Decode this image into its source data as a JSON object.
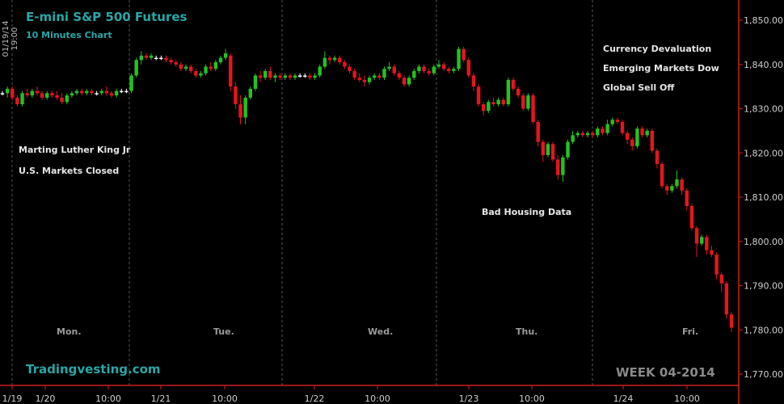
{
  "header": {
    "title": "E-mini S&P 500 Futures",
    "subtitle": "10 Minutes Chart",
    "timestamp": "01/19/14 19:00"
  },
  "footer": {
    "brand": "Tradingvesting.com",
    "week": "WEEK 04-2014"
  },
  "annotations": {
    "mlk_line1": "Marting Luther King Jr",
    "mlk_line2": "U.S. Markets Closed",
    "housing": "Bad Housing Data",
    "currency": "Currency Devaluation",
    "emerging": "Emerging Markets Dow",
    "selloff": "Global Sell Off"
  },
  "days": {
    "mon": "Mon.",
    "tue": "Tue.",
    "wed": "Wed.",
    "thu": "Thu.",
    "fri": "Fri."
  },
  "colors": {
    "background": "#000000",
    "up_candle": "#22c322",
    "down_candle": "#e8141e",
    "axis_line": "#cc1f1f",
    "title": "#2aa6a6"
  },
  "chart_data": {
    "type": "candlestick",
    "title": "E-mini S&P 500 Futures",
    "subtitle": "10 Minutes Chart",
    "ylim": [
      1770,
      1855
    ],
    "y_ticks": [
      "1,770.00",
      "1,780.00",
      "1,790.00",
      "1,800.00",
      "1,810.00",
      "1,820.00",
      "1,830.00",
      "1,840.00",
      "1,850.00"
    ],
    "x_ticks": [
      "1/19",
      "1/20",
      "10:00",
      "1/21",
      "10:00",
      "1/22",
      "10:00",
      "1/23",
      "10:00",
      "1/24",
      "10:00"
    ],
    "candles": [
      [
        1833.5,
        1834.0,
        1833.0,
        1833.5
      ],
      [
        1833.5,
        1835.0,
        1832.5,
        1834.5
      ],
      [
        1834.5,
        1835.0,
        1832.0,
        1832.5
      ],
      [
        1832.5,
        1833.0,
        1830.5,
        1831.0
      ],
      [
        1831.0,
        1834.0,
        1830.5,
        1833.5
      ],
      [
        1833.5,
        1834.5,
        1832.5,
        1833.0
      ],
      [
        1833.0,
        1834.5,
        1832.5,
        1834.0
      ],
      [
        1834.0,
        1835.0,
        1833.0,
        1833.5
      ],
      [
        1833.5,
        1834.0,
        1832.0,
        1832.5
      ],
      [
        1832.5,
        1834.0,
        1832.0,
        1833.5
      ],
      [
        1833.5,
        1834.0,
        1832.5,
        1833.0
      ],
      [
        1833.0,
        1834.0,
        1832.0,
        1832.5
      ],
      [
        1832.5,
        1833.5,
        1831.0,
        1831.5
      ],
      [
        1831.5,
        1833.5,
        1831.0,
        1833.0
      ],
      [
        1833.0,
        1834.0,
        1832.5,
        1833.5
      ],
      [
        1833.5,
        1834.5,
        1833.0,
        1834.0
      ],
      [
        1834.0,
        1834.5,
        1833.0,
        1833.5
      ],
      [
        1833.5,
        1834.5,
        1833.0,
        1834.0
      ],
      [
        1834.0,
        1834.5,
        1833.0,
        1833.5
      ],
      [
        1833.5,
        1834.0,
        1833.0,
        1833.5
      ],
      [
        1833.5,
        1834.5,
        1833.0,
        1834.0
      ],
      [
        1834.0,
        1835.0,
        1833.0,
        1833.5
      ],
      [
        1833.5,
        1834.0,
        1832.5,
        1833.0
      ],
      [
        1833.0,
        1834.5,
        1832.5,
        1834.0
      ],
      [
        1834.0,
        1834.5,
        1833.5,
        1834.0
      ],
      [
        1834.0,
        1834.5,
        1833.5,
        1834.0
      ],
      [
        1834.0,
        1838.0,
        1833.5,
        1837.5
      ],
      [
        1837.5,
        1841.5,
        1837.0,
        1841.0
      ],
      [
        1841.0,
        1843.0,
        1840.0,
        1842.0
      ],
      [
        1842.0,
        1842.5,
        1841.0,
        1841.5
      ],
      [
        1841.5,
        1842.5,
        1841.0,
        1842.0
      ],
      [
        1841.5,
        1842.0,
        1841.0,
        1841.5
      ],
      [
        1841.5,
        1842.0,
        1841.0,
        1841.5
      ],
      [
        1841.5,
        1842.0,
        1840.5,
        1841.0
      ],
      [
        1841.0,
        1841.5,
        1840.0,
        1840.5
      ],
      [
        1840.5,
        1841.0,
        1839.5,
        1840.0
      ],
      [
        1840.0,
        1840.5,
        1838.5,
        1839.0
      ],
      [
        1839.0,
        1840.0,
        1838.5,
        1839.5
      ],
      [
        1839.5,
        1840.0,
        1838.0,
        1838.5
      ],
      [
        1838.5,
        1839.0,
        1837.0,
        1837.5
      ],
      [
        1837.5,
        1838.5,
        1837.0,
        1838.0
      ],
      [
        1838.0,
        1840.0,
        1837.5,
        1839.5
      ],
      [
        1839.5,
        1840.5,
        1838.5,
        1839.0
      ],
      [
        1839.0,
        1841.0,
        1838.5,
        1840.5
      ],
      [
        1840.5,
        1842.0,
        1840.0,
        1841.5
      ],
      [
        1841.5,
        1843.5,
        1841.0,
        1842.5
      ],
      [
        1842.0,
        1842.5,
        1834.0,
        1835.0
      ],
      [
        1835.0,
        1836.0,
        1830.0,
        1831.0
      ],
      [
        1831.0,
        1833.0,
        1826.5,
        1828.0
      ],
      [
        1828.0,
        1833.0,
        1826.5,
        1832.5
      ],
      [
        1832.5,
        1835.0,
        1832.0,
        1834.5
      ],
      [
        1834.5,
        1838.0,
        1834.0,
        1837.5
      ],
      [
        1837.5,
        1838.5,
        1836.0,
        1837.0
      ],
      [
        1837.0,
        1839.0,
        1836.5,
        1838.5
      ],
      [
        1838.5,
        1839.5,
        1836.5,
        1837.0
      ],
      [
        1837.0,
        1838.0,
        1836.0,
        1837.5
      ],
      [
        1837.5,
        1838.0,
        1836.5,
        1837.0
      ],
      [
        1837.0,
        1838.0,
        1836.5,
        1837.5
      ],
      [
        1837.5,
        1838.0,
        1836.5,
        1837.0
      ],
      [
        1837.0,
        1838.0,
        1836.5,
        1837.5
      ],
      [
        1837.5,
        1838.0,
        1837.0,
        1837.5
      ],
      [
        1837.5,
        1838.0,
        1837.0,
        1837.5
      ],
      [
        1837.5,
        1838.0,
        1836.5,
        1837.0
      ],
      [
        1837.0,
        1838.0,
        1836.5,
        1837.5
      ],
      [
        1837.5,
        1840.0,
        1837.0,
        1839.5
      ],
      [
        1839.5,
        1843.0,
        1839.0,
        1841.5
      ],
      [
        1841.5,
        1842.0,
        1840.0,
        1841.0
      ],
      [
        1841.0,
        1842.0,
        1840.5,
        1841.5
      ],
      [
        1841.5,
        1842.0,
        1840.0,
        1840.5
      ],
      [
        1840.5,
        1841.0,
        1839.0,
        1839.5
      ],
      [
        1839.5,
        1840.0,
        1838.0,
        1838.5
      ],
      [
        1838.5,
        1839.0,
        1836.5,
        1837.0
      ],
      [
        1837.0,
        1838.0,
        1836.0,
        1836.5
      ],
      [
        1836.5,
        1837.5,
        1835.0,
        1836.0
      ],
      [
        1836.0,
        1837.5,
        1835.5,
        1837.0
      ],
      [
        1837.0,
        1838.0,
        1836.5,
        1837.5
      ],
      [
        1837.5,
        1838.0,
        1836.5,
        1837.0
      ],
      [
        1837.0,
        1839.5,
        1836.5,
        1839.0
      ],
      [
        1839.0,
        1840.5,
        1838.5,
        1839.5
      ],
      [
        1839.5,
        1840.0,
        1837.5,
        1838.0
      ],
      [
        1838.0,
        1838.5,
        1836.5,
        1837.0
      ],
      [
        1837.0,
        1837.5,
        1835.0,
        1835.5
      ],
      [
        1835.5,
        1837.5,
        1835.0,
        1837.0
      ],
      [
        1837.0,
        1839.0,
        1836.5,
        1838.5
      ],
      [
        1838.5,
        1840.0,
        1838.0,
        1839.5
      ],
      [
        1839.5,
        1840.0,
        1838.0,
        1838.5
      ],
      [
        1838.5,
        1839.0,
        1837.5,
        1838.0
      ],
      [
        1838.0,
        1840.0,
        1837.5,
        1839.5
      ],
      [
        1839.5,
        1841.0,
        1839.0,
        1840.0
      ],
      [
        1840.0,
        1840.5,
        1838.5,
        1839.0
      ],
      [
        1839.0,
        1839.5,
        1838.0,
        1838.5
      ],
      [
        1838.5,
        1839.5,
        1838.0,
        1839.0
      ],
      [
        1839.0,
        1844.0,
        1838.5,
        1843.5
      ],
      [
        1843.5,
        1844.0,
        1840.5,
        1841.0
      ],
      [
        1841.0,
        1841.5,
        1837.0,
        1837.5
      ],
      [
        1837.5,
        1838.0,
        1834.0,
        1835.0
      ],
      [
        1835.0,
        1835.5,
        1830.5,
        1831.0
      ],
      [
        1831.0,
        1831.5,
        1828.5,
        1829.5
      ],
      [
        1829.5,
        1832.0,
        1829.0,
        1831.5
      ],
      [
        1831.5,
        1832.5,
        1830.5,
        1831.0
      ],
      [
        1831.0,
        1832.5,
        1830.5,
        1832.0
      ],
      [
        1832.0,
        1832.5,
        1830.5,
        1831.0
      ],
      [
        1831.0,
        1837.0,
        1830.5,
        1836.5
      ],
      [
        1836.5,
        1837.0,
        1834.0,
        1834.5
      ],
      [
        1834.5,
        1835.0,
        1832.5,
        1833.0
      ],
      [
        1833.0,
        1833.5,
        1829.5,
        1830.0
      ],
      [
        1830.0,
        1833.5,
        1829.5,
        1833.0
      ],
      [
        1833.0,
        1833.5,
        1826.5,
        1827.0
      ],
      [
        1827.0,
        1827.5,
        1821.5,
        1822.5
      ],
      [
        1822.5,
        1823.0,
        1818.0,
        1819.5
      ],
      [
        1819.5,
        1822.5,
        1819.0,
        1822.0
      ],
      [
        1822.0,
        1822.5,
        1818.0,
        1818.5
      ],
      [
        1818.5,
        1819.5,
        1814.0,
        1815.0
      ],
      [
        1815.0,
        1819.5,
        1813.5,
        1819.0
      ],
      [
        1819.0,
        1823.0,
        1818.5,
        1822.5
      ],
      [
        1822.5,
        1825.0,
        1822.0,
        1824.0
      ],
      [
        1824.0,
        1825.0,
        1823.5,
        1824.5
      ],
      [
        1824.5,
        1825.0,
        1823.5,
        1824.0
      ],
      [
        1824.0,
        1825.0,
        1823.5,
        1824.5
      ],
      [
        1824.5,
        1825.0,
        1823.5,
        1824.0
      ],
      [
        1824.0,
        1826.0,
        1823.5,
        1825.5
      ],
      [
        1825.5,
        1826.0,
        1824.0,
        1824.5
      ],
      [
        1824.5,
        1827.5,
        1824.0,
        1826.5
      ],
      [
        1826.5,
        1828.0,
        1826.0,
        1827.5
      ],
      [
        1827.5,
        1828.0,
        1826.5,
        1827.0
      ],
      [
        1827.0,
        1827.5,
        1824.0,
        1824.5
      ],
      [
        1824.5,
        1825.0,
        1822.0,
        1823.0
      ],
      [
        1823.0,
        1823.5,
        1820.5,
        1821.5
      ],
      [
        1821.5,
        1826.0,
        1821.0,
        1825.5
      ],
      [
        1825.5,
        1826.0,
        1823.5,
        1824.0
      ],
      [
        1824.0,
        1825.5,
        1823.5,
        1825.0
      ],
      [
        1825.0,
        1825.5,
        1820.0,
        1820.5
      ],
      [
        1820.5,
        1821.0,
        1816.5,
        1817.5
      ],
      [
        1817.5,
        1818.0,
        1812.0,
        1812.5
      ],
      [
        1812.5,
        1813.0,
        1810.5,
        1811.5
      ],
      [
        1811.5,
        1813.0,
        1811.0,
        1812.5
      ],
      [
        1812.5,
        1816.0,
        1812.0,
        1814.0
      ],
      [
        1814.0,
        1814.5,
        1810.5,
        1811.5
      ],
      [
        1811.5,
        1812.0,
        1807.0,
        1808.0
      ],
      [
        1808.0,
        1808.5,
        1802.5,
        1803.0
      ],
      [
        1803.0,
        1803.5,
        1796.5,
        1799.5
      ],
      [
        1799.5,
        1801.5,
        1799.0,
        1801.0
      ],
      [
        1801.0,
        1801.5,
        1797.0,
        1798.0
      ],
      [
        1798.0,
        1799.0,
        1796.5,
        1797.0
      ],
      [
        1797.0,
        1797.5,
        1791.5,
        1792.5
      ],
      [
        1792.5,
        1793.0,
        1788.5,
        1790.5
      ],
      [
        1790.5,
        1791.0,
        1782.5,
        1783.5
      ],
      [
        1783.5,
        1784.0,
        1779.5,
        1780.5
      ]
    ]
  }
}
